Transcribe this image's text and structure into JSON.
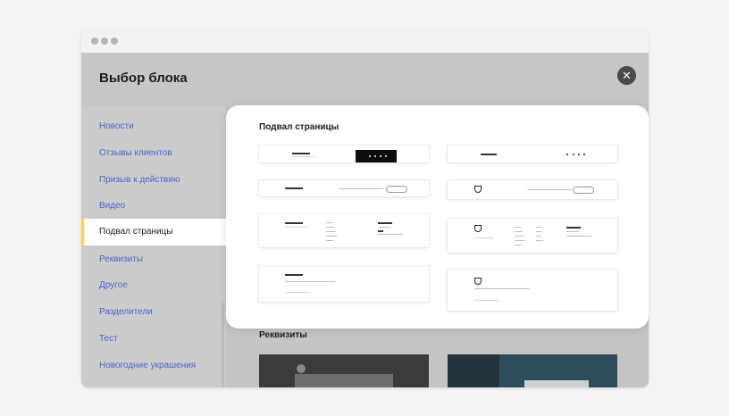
{
  "header": {
    "title": "Выбор блока",
    "close_icon": "close-icon"
  },
  "sidebar": {
    "items": [
      {
        "label": "Новости",
        "active": false
      },
      {
        "label": "Отзывы клиентов",
        "active": false
      },
      {
        "label": "Призыв к действию",
        "active": false
      },
      {
        "label": "Видео",
        "active": false
      },
      {
        "label": "Подвал страницы",
        "active": true
      },
      {
        "label": "Реквизиты",
        "active": false
      },
      {
        "label": "Другое",
        "active": false
      },
      {
        "label": "Разделители",
        "active": false
      },
      {
        "label": "Тест",
        "active": false
      },
      {
        "label": "Новогодние украшения",
        "active": false
      }
    ]
  },
  "modal": {
    "title": "Подвал страницы"
  },
  "next_section": {
    "title": "Реквизиты"
  },
  "colors": {
    "accent": "#ffd23f",
    "link": "#4466c9",
    "close_button": "#4a4a4a"
  }
}
